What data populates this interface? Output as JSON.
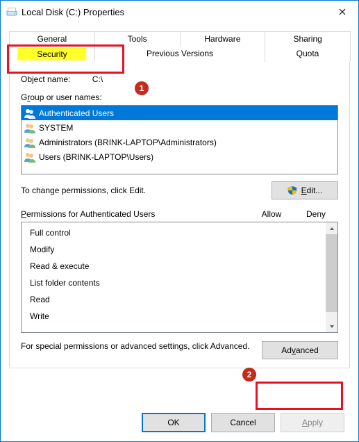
{
  "titlebar": {
    "title": "Local Disk (C:) Properties"
  },
  "tabs": {
    "row1": [
      "General",
      "Tools",
      "Hardware",
      "Sharing"
    ],
    "row2": [
      "Security",
      "Previous Versions",
      "Quota"
    ],
    "active": "Security"
  },
  "object": {
    "label": "Object name:",
    "value": "C:\\"
  },
  "groups": {
    "label_pre": "G",
    "label_ul": "r",
    "label_post": "oup or user names:",
    "items": [
      {
        "name": "Authenticated Users",
        "selected": true
      },
      {
        "name": "SYSTEM",
        "selected": false
      },
      {
        "name": "Administrators (BRINK-LAPTOP\\Administrators)",
        "selected": false
      },
      {
        "name": "Users (BRINK-LAPTOP\\Users)",
        "selected": false
      }
    ]
  },
  "edit": {
    "text": "To change permissions, click Edit.",
    "button_ul": "E",
    "button_post": "dit..."
  },
  "permissions": {
    "header_pre": "P",
    "header_post": "ermissions for Authenticated Users",
    "col_allow": "Allow",
    "col_deny": "Deny",
    "items": [
      "Full control",
      "Modify",
      "Read & execute",
      "List folder contents",
      "Read",
      "Write"
    ]
  },
  "advanced": {
    "text": "For special permissions or advanced settings, click Advanced.",
    "button_pre": "Ad",
    "button_ul": "v",
    "button_post": "anced"
  },
  "footer": {
    "ok": "OK",
    "cancel": "Cancel",
    "apply_ul": "A",
    "apply_post": "pply"
  },
  "annotations": {
    "step1": "1",
    "step2": "2"
  }
}
